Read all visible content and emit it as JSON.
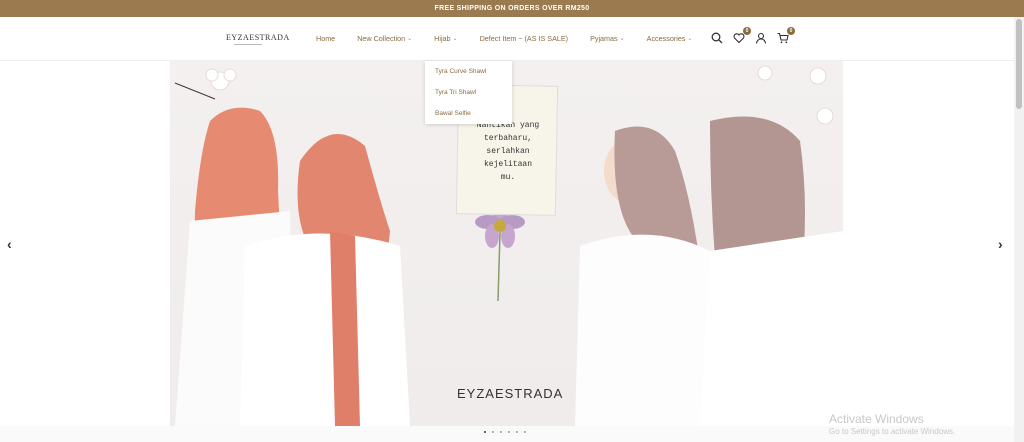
{
  "announcement": "FREE SHIPPING ON ORDERS OVER RM250",
  "logo": "EYZAESTRADA",
  "nav": [
    {
      "label": "Home",
      "chevron": false
    },
    {
      "label": "New Collection",
      "chevron": true
    },
    {
      "label": "Hijab",
      "chevron": true
    },
    {
      "label": "Defect Item ~ (AS IS SALE)",
      "chevron": false
    },
    {
      "label": "Pyjamas",
      "chevron": true
    },
    {
      "label": "Accessories",
      "chevron": true
    }
  ],
  "dropdown": [
    "Tyra Curve Shawl",
    "Tyra Tri Shawl",
    "Bawal Selfie"
  ],
  "badges": {
    "wishlist": "0",
    "cart": "0"
  },
  "hero": {
    "note_lines": [
      "Nantikan yang",
      "terbaharu,",
      "serlahkan",
      "kejelitaan",
      "mu."
    ],
    "brand": "EYZAESTRADA"
  },
  "slider": {
    "prev": "‹",
    "next": "›",
    "dots": 6,
    "active": 0
  },
  "windows": {
    "title": "Activate Windows",
    "sub": "Go to Settings to activate Windows."
  },
  "colors": {
    "accent": "#8a6a3f",
    "topbar": "#9c7a4f",
    "coral": "#e78a72",
    "mauve": "#b89a96"
  }
}
